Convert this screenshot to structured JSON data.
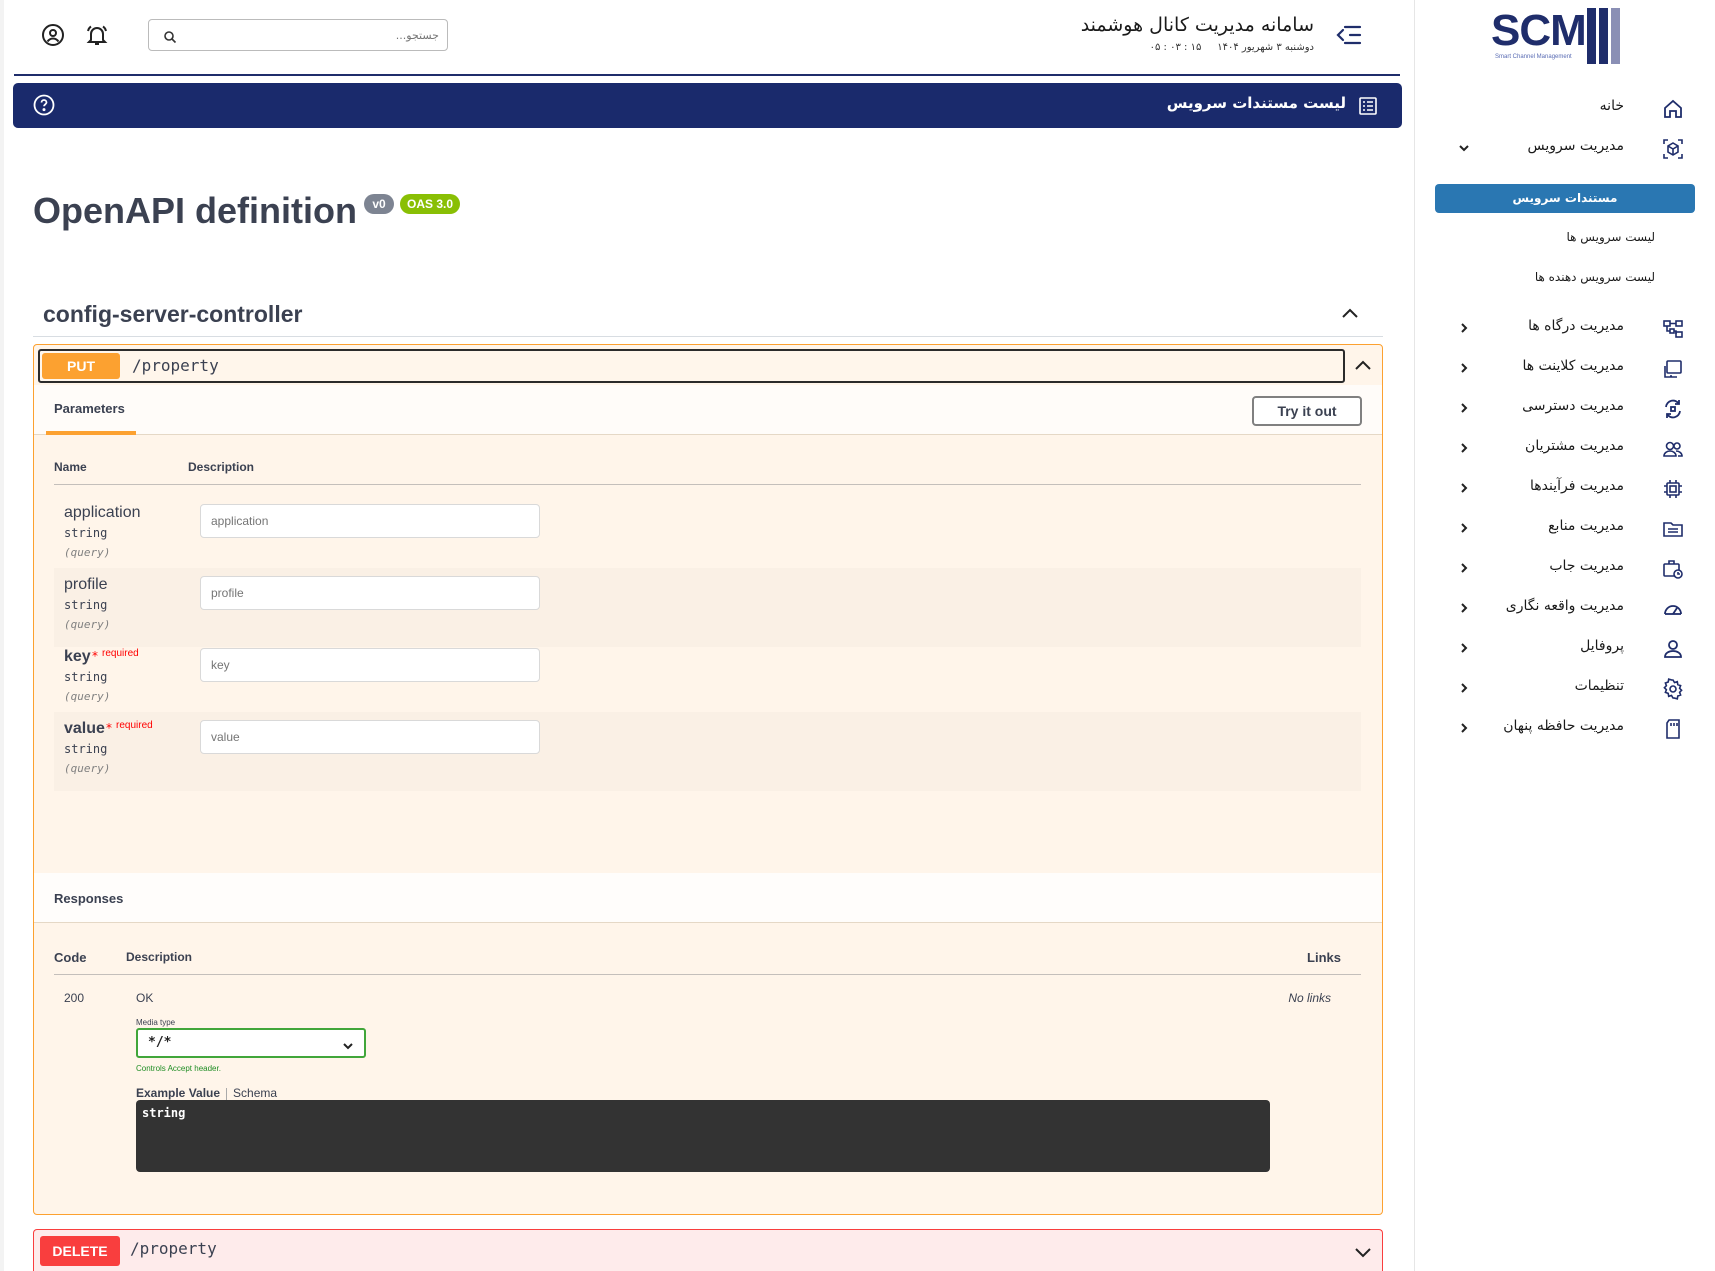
{
  "colors": {
    "brand": "#1a2a6c",
    "accent": "#2a77b2",
    "put": "#fca130",
    "delete": "#f93e3e",
    "logo_bars": [
      "#1f2d6b",
      "#1f2d6b",
      "#8a8fb5"
    ]
  },
  "sidebar": {
    "logo_text": "SCM",
    "logo_sub": "Smart Channel Management",
    "items": [
      {
        "label": "خانه",
        "icon": "home-icon",
        "chevron": "none"
      },
      {
        "label": "مدیریت سرویس",
        "icon": "service-box-icon",
        "chevron": "down"
      },
      {
        "label": "مدیریت درگاه ها",
        "icon": "gateway-icon",
        "chevron": "left"
      },
      {
        "label": "مدیریت کلاینت ها",
        "icon": "client-icon",
        "chevron": "left"
      },
      {
        "label": "مدیریت دسترسی",
        "icon": "access-icon",
        "chevron": "left"
      },
      {
        "label": "مدیریت مشتریان",
        "icon": "customers-icon",
        "chevron": "left"
      },
      {
        "label": "مدیریت فرآیندها",
        "icon": "process-chip-icon",
        "chevron": "left"
      },
      {
        "label": "مدیریت منابع",
        "icon": "resources-folder-icon",
        "chevron": "left"
      },
      {
        "label": "مدیریت جاب",
        "icon": "job-briefcase-icon",
        "chevron": "left"
      },
      {
        "label": "مدیریت واقعه نگاری",
        "icon": "logging-gauge-icon",
        "chevron": "left"
      },
      {
        "label": "پروفایل",
        "icon": "profile-user-icon",
        "chevron": "left"
      },
      {
        "label": "تنظیمات",
        "icon": "settings-gear-icon",
        "chevron": "left"
      },
      {
        "label": "مدیریت حافظه پنهان",
        "icon": "cache-card-icon",
        "chevron": "left"
      }
    ],
    "sub_items": {
      "active": "مستندات سرویس",
      "list_services": "لیست سرویس ها",
      "list_providers": "لیست سرویس دهنده ها"
    }
  },
  "header": {
    "title": "سامانه مدیریت کانال هوشمند",
    "date": "دوشنبه ۳ شهریور ۱۴۰۴",
    "time": "۱۵ : ۰۳ : ۰۵",
    "search_placeholder": "جستجو...",
    "banner_title": "لیست مستندات سرویس"
  },
  "swagger": {
    "title": "OpenAPI definition",
    "version_badge": "v0",
    "oas_badge": "OAS 3.0",
    "tag": "config-server-controller",
    "put_op": {
      "method": "PUT",
      "path": "/property",
      "tab_label": "Parameters",
      "try_label": "Try it out",
      "col_name": "Name",
      "col_desc": "Description",
      "params": [
        {
          "name": "application",
          "type": "string",
          "in": "(query)",
          "required": false,
          "placeholder": "application"
        },
        {
          "name": "profile",
          "type": "string",
          "in": "(query)",
          "required": false,
          "placeholder": "profile"
        },
        {
          "name": "key",
          "type": "string",
          "in": "(query)",
          "required": true,
          "placeholder": "key"
        },
        {
          "name": "value",
          "type": "string",
          "in": "(query)",
          "required": true,
          "placeholder": "value"
        }
      ],
      "required_star": "*",
      "required_label": "required",
      "responses_title": "Responses",
      "resp_col_code": "Code",
      "resp_col_desc": "Description",
      "resp_col_links": "Links",
      "response": {
        "code": "200",
        "desc": "OK",
        "links": "No links",
        "media_label": "Media type",
        "media_value": "*/*",
        "media_note": "Controls Accept header.",
        "example_tab": "Example Value",
        "schema_tab": "Schema",
        "example_body": "string"
      }
    },
    "delete_op": {
      "method": "DELETE",
      "path": "/property"
    }
  }
}
